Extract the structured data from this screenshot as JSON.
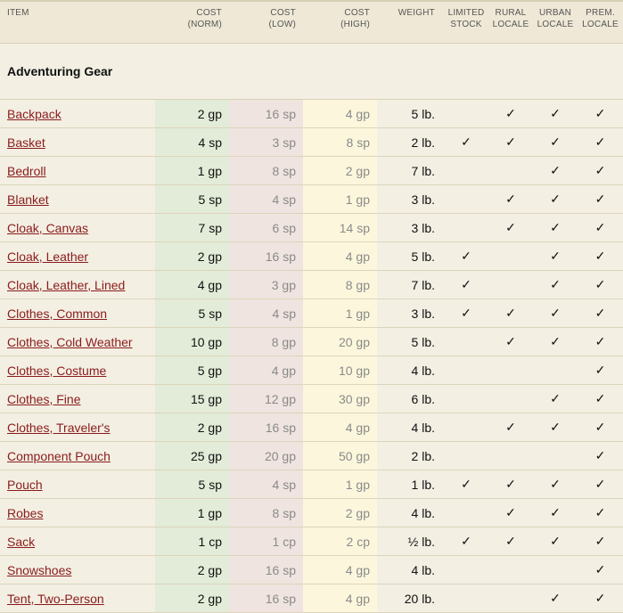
{
  "headers": {
    "item": "ITEM",
    "cost_norm": [
      "COST",
      "(NORM)"
    ],
    "cost_low": [
      "COST",
      "(LOW)"
    ],
    "cost_high": [
      "COST",
      "(HIGH)"
    ],
    "weight": "WEIGHT",
    "limited": [
      "LIMITED",
      "STOCK"
    ],
    "rural": [
      "RURAL",
      "LOCALE"
    ],
    "urban": [
      "URBAN",
      "LOCALE"
    ],
    "prem": [
      "PREM.",
      "LOCALE"
    ]
  },
  "section_title": "Adventuring Gear",
  "check_glyph": "✓",
  "rows": [
    {
      "name": "Backpack",
      "norm": "2 gp",
      "low": "16 sp",
      "high": "4 gp",
      "weight": "5 lb.",
      "limited": "",
      "rural": "✓",
      "urban": "✓",
      "prem": "✓"
    },
    {
      "name": "Basket",
      "norm": "4 sp",
      "low": "3 sp",
      "high": "8 sp",
      "weight": "2 lb.",
      "limited": "✓",
      "rural": "✓",
      "urban": "✓",
      "prem": "✓"
    },
    {
      "name": "Bedroll",
      "norm": "1 gp",
      "low": "8 sp",
      "high": "2 gp",
      "weight": "7 lb.",
      "limited": "",
      "rural": "",
      "urban": "✓",
      "prem": "✓"
    },
    {
      "name": "Blanket",
      "norm": "5 sp",
      "low": "4 sp",
      "high": "1 gp",
      "weight": "3 lb.",
      "limited": "",
      "rural": "✓",
      "urban": "✓",
      "prem": "✓"
    },
    {
      "name": "Cloak, Canvas",
      "norm": "7 sp",
      "low": "6 sp",
      "high": "14 sp",
      "weight": "3 lb.",
      "limited": "",
      "rural": "✓",
      "urban": "✓",
      "prem": "✓"
    },
    {
      "name": "Cloak, Leather",
      "norm": "2 gp",
      "low": "16 sp",
      "high": "4 gp",
      "weight": "5 lb.",
      "limited": "✓",
      "rural": "",
      "urban": "✓",
      "prem": "✓"
    },
    {
      "name": "Cloak, Leather, Lined",
      "norm": "4 gp",
      "low": "3 gp",
      "high": "8 gp",
      "weight": "7 lb.",
      "limited": "✓",
      "rural": "",
      "urban": "✓",
      "prem": "✓"
    },
    {
      "name": "Clothes, Common",
      "norm": "5 sp",
      "low": "4 sp",
      "high": "1 gp",
      "weight": "3 lb.",
      "limited": "✓",
      "rural": "✓",
      "urban": "✓",
      "prem": "✓"
    },
    {
      "name": "Clothes, Cold Weather",
      "norm": "10 gp",
      "low": "8 gp",
      "high": "20 gp",
      "weight": "5 lb.",
      "limited": "",
      "rural": "✓",
      "urban": "✓",
      "prem": "✓"
    },
    {
      "name": "Clothes, Costume",
      "norm": "5 gp",
      "low": "4 gp",
      "high": "10 gp",
      "weight": "4 lb.",
      "limited": "",
      "rural": "",
      "urban": "",
      "prem": "✓"
    },
    {
      "name": "Clothes, Fine",
      "norm": "15 gp",
      "low": "12 gp",
      "high": "30 gp",
      "weight": "6 lb.",
      "limited": "",
      "rural": "",
      "urban": "✓",
      "prem": "✓"
    },
    {
      "name": "Clothes, Traveler's",
      "norm": "2 gp",
      "low": "16 sp",
      "high": "4 gp",
      "weight": "4 lb.",
      "limited": "",
      "rural": "✓",
      "urban": "✓",
      "prem": "✓"
    },
    {
      "name": "Component Pouch",
      "norm": "25 gp",
      "low": "20 gp",
      "high": "50 gp",
      "weight": "2 lb.",
      "limited": "",
      "rural": "",
      "urban": "",
      "prem": "✓"
    },
    {
      "name": "Pouch",
      "norm": "5 sp",
      "low": "4 sp",
      "high": "1 gp",
      "weight": "1 lb.",
      "limited": "✓",
      "rural": "✓",
      "urban": "✓",
      "prem": "✓"
    },
    {
      "name": "Robes",
      "norm": "1 gp",
      "low": "8 sp",
      "high": "2 gp",
      "weight": "4 lb.",
      "limited": "",
      "rural": "✓",
      "urban": "✓",
      "prem": "✓"
    },
    {
      "name": "Sack",
      "norm": "1 cp",
      "low": "1 cp",
      "high": "2 cp",
      "weight": "½ lb.",
      "limited": "✓",
      "rural": "✓",
      "urban": "✓",
      "prem": "✓"
    },
    {
      "name": "Snowshoes",
      "norm": "2 gp",
      "low": "16 sp",
      "high": "4 gp",
      "weight": "4 lb.",
      "limited": "",
      "rural": "",
      "urban": "",
      "prem": "✓"
    },
    {
      "name": "Tent, Two-Person",
      "norm": "2 gp",
      "low": "16 sp",
      "high": "4 gp",
      "weight": "20 lb.",
      "limited": "",
      "rural": "",
      "urban": "✓",
      "prem": "✓"
    }
  ],
  "colors": {
    "link": "#8a1c1c",
    "norm_bg": "#e2ecd8",
    "low_bg": "#efe4df",
    "high_bg": "#fcf7dc",
    "page_bg": "#f3efe3"
  }
}
